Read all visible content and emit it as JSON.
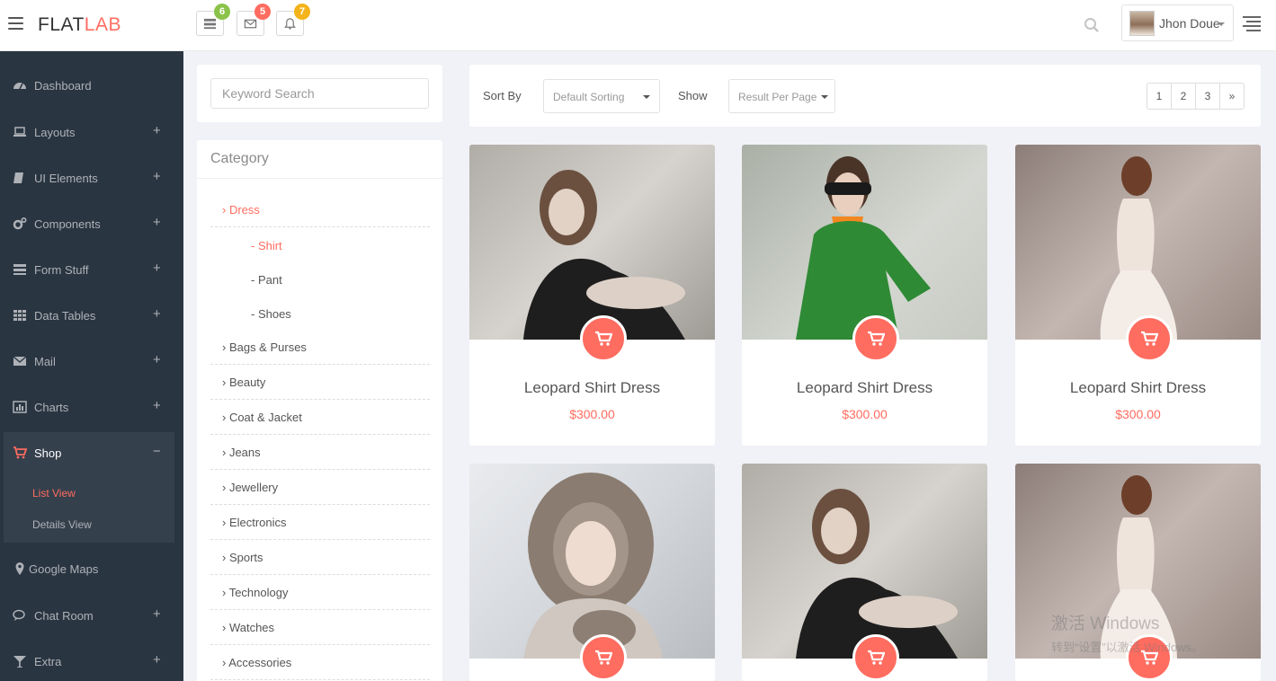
{
  "header": {
    "logo_main": "FLAT",
    "logo_accent": "LAB",
    "notifications": [
      {
        "icon": "tasks-icon",
        "count": "6",
        "color": "#8bc34a"
      },
      {
        "icon": "envelope-icon",
        "count": "5",
        "color": "#ff6c60"
      },
      {
        "icon": "bell-icon",
        "count": "7",
        "color": "#f4b31a"
      }
    ],
    "user_name": "Jhon Doue"
  },
  "sidebar": {
    "items": [
      {
        "label": "Dashboard",
        "icon": "dashboard-icon",
        "plus": ""
      },
      {
        "label": "Layouts",
        "icon": "laptop-icon",
        "plus": "+"
      },
      {
        "label": "UI Elements",
        "icon": "book-icon",
        "plus": "+"
      },
      {
        "label": "Components",
        "icon": "cogs-icon",
        "plus": "+"
      },
      {
        "label": "Form Stuff",
        "icon": "tasks-icon",
        "plus": "+"
      },
      {
        "label": "Data Tables",
        "icon": "th-icon",
        "plus": "+"
      },
      {
        "label": "Mail",
        "icon": "envelope-icon",
        "plus": "+"
      },
      {
        "label": "Charts",
        "icon": "bar-chart-icon",
        "plus": "+"
      },
      {
        "label": "Shop",
        "icon": "cart-icon",
        "plus": "−"
      },
      {
        "label": "Google Maps",
        "icon": "map-marker-icon",
        "plus": ""
      },
      {
        "label": "Chat Room",
        "icon": "comments-icon",
        "plus": "+"
      },
      {
        "label": "Extra",
        "icon": "glass-icon",
        "plus": "+"
      }
    ],
    "shop_sub": [
      "List View",
      "Details View"
    ]
  },
  "search": {
    "placeholder": "Keyword Search"
  },
  "category": {
    "title": "Category",
    "top": "› Dress",
    "subs": [
      "- Shirt",
      "- Pant",
      "- Shoes"
    ],
    "rows": [
      "› Bags & Purses",
      "› Beauty",
      "› Coat & Jacket",
      "› Jeans",
      "› Jewellery",
      "› Electronics",
      "› Sports",
      "› Technology",
      "› Watches",
      "› Accessories"
    ]
  },
  "toolbar": {
    "sort_label": "Sort By",
    "sort_value": "Default Sorting",
    "show_label": "Show",
    "show_value": "Result Per Page",
    "pages": [
      "1",
      "2",
      "3",
      "»"
    ]
  },
  "products": [
    {
      "name": "Leopard Shirt Dress",
      "price": "$300.00"
    },
    {
      "name": "Leopard Shirt Dress",
      "price": "$300.00"
    },
    {
      "name": "Leopard Shirt Dress",
      "price": "$300.00"
    },
    {
      "name": "",
      "price": ""
    },
    {
      "name": "",
      "price": ""
    },
    {
      "name": "",
      "price": ""
    }
  ],
  "watermark": {
    "line1": "激活 Windows",
    "line2": "转到“设置”以激活 Windows。"
  },
  "colors": {
    "accent": "#ff6c60",
    "sidebar": "#2a3542",
    "background": "#f1f2f7"
  }
}
